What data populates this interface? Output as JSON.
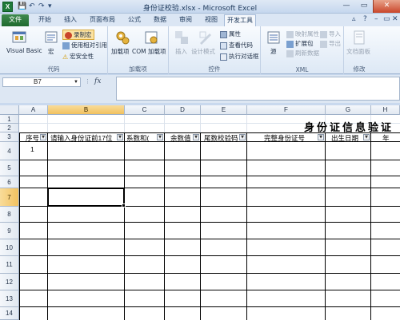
{
  "window": {
    "title": "身份证校验.xlsx - Microsoft Excel",
    "app_icon_letter": "X",
    "controls": [
      "—",
      "▭",
      "✕"
    ]
  },
  "ribbon_tabs": [
    "文件",
    "开始",
    "插入",
    "页面布局",
    "公式",
    "数据",
    "审阅",
    "视图",
    "开发工具"
  ],
  "active_tab": "开发工具",
  "ribbon": {
    "groups": [
      {
        "label": "代码",
        "buttons": [
          "Visual Basic",
          "宏",
          "录制宏",
          "使用相对引用",
          "宏安全性"
        ]
      },
      {
        "label": "加载项",
        "buttons": [
          "加载项",
          "COM 加载项"
        ]
      },
      {
        "label": "控件",
        "buttons": [
          "插入",
          "设计模式",
          "属性",
          "查看代码",
          "执行对话框"
        ]
      },
      {
        "label": "XML",
        "buttons": [
          "源",
          "映射属性",
          "扩展包",
          "刷新数据",
          "导入",
          "导出"
        ]
      },
      {
        "label": "修改",
        "buttons": [
          "文档面板"
        ]
      }
    ]
  },
  "formula_bar": {
    "name_box": "B7",
    "fx": "fx",
    "value": ""
  },
  "columns": [
    "A",
    "B",
    "C",
    "D",
    "E",
    "F",
    "G",
    "H"
  ],
  "selected_column": "B",
  "rows": [
    "1",
    "2",
    "3",
    "4",
    "5",
    "6",
    "7",
    "8",
    "9",
    "10",
    "11",
    "12",
    "13",
    "14"
  ],
  "selected_row": "7",
  "sheet": {
    "banner": "身份证信息验证",
    "headers": [
      "序号",
      "请输入身份证前17位",
      "系数和(",
      "余数值",
      "尾数校验码",
      "完整身份证号",
      "出生日期",
      "年"
    ],
    "row4": {
      "A": "1"
    }
  }
}
